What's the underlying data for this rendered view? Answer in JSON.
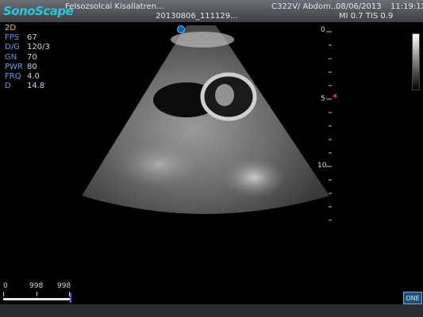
{
  "header": {
    "brand": "SonoScape",
    "hospital": "Felsozsolcai Kisallatren...",
    "study_id": "20130806_111129...",
    "probe_preset": "C322V/ Abdom...",
    "date": "08/06/2013",
    "time": "11:19:12",
    "indices": "MI 0.7  TIS 0.9"
  },
  "params": {
    "mode": "2D",
    "rows": [
      {
        "key": "FPS",
        "value": "67"
      },
      {
        "key": "D/G",
        "value": "120/3"
      },
      {
        "key": "GN",
        "value": "70"
      },
      {
        "key": "PWR",
        "value": "80"
      },
      {
        "key": "FRQ",
        "value": "4.0"
      },
      {
        "key": "D",
        "value": "14.8"
      }
    ]
  },
  "depth_scale": {
    "labels": [
      "0",
      "5",
      "10"
    ],
    "focus_color": "#e03030"
  },
  "cine_ruler": {
    "start": "0",
    "mid": "998",
    "end": "998"
  },
  "controls": {
    "one_label": "ONE"
  },
  "colors": {
    "brand": "#2ec4d6",
    "param_key": "#5aa0e8",
    "mode": "#f2c23a"
  }
}
